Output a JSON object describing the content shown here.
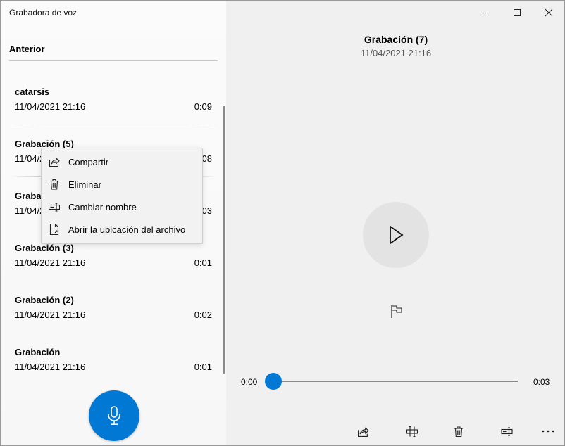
{
  "app": {
    "title": "Grabadora de voz"
  },
  "list": {
    "header": "Anterior",
    "recordings": [
      {
        "name": "catarsis",
        "date": "11/04/2021 21:16",
        "duration": "0:09"
      },
      {
        "name": "Grabación (5)",
        "date": "11/04/2021 21:16",
        "duration": "0:08"
      },
      {
        "name": "Grabación (4)",
        "date": "11/04/2021 21:16",
        "duration": "0:03"
      },
      {
        "name": "Grabación (3)",
        "date": "11/04/2021 21:16",
        "duration": "0:01"
      },
      {
        "name": "Grabación (2)",
        "date": "11/04/2021 21:16",
        "duration": "0:02"
      },
      {
        "name": "Grabación",
        "date": "11/04/2021 21:16",
        "duration": "0:01"
      }
    ]
  },
  "context_menu": {
    "items": [
      {
        "label": "Compartir",
        "icon": "share-icon"
      },
      {
        "label": "Eliminar",
        "icon": "trash-icon"
      },
      {
        "label": "Cambiar nombre",
        "icon": "rename-icon"
      },
      {
        "label": "Abrir la ubicación del archivo",
        "icon": "file-location-icon"
      }
    ]
  },
  "player": {
    "title": "Grabación (7)",
    "subtitle": "11/04/2021 21:16",
    "time_current": "0:00",
    "time_total": "0:03",
    "progress": 0
  },
  "window_controls": [
    "minimize-icon",
    "maximize-icon",
    "close-icon"
  ],
  "colors": {
    "accent": "#0078d4",
    "window_bg": "#f0f0f0"
  }
}
